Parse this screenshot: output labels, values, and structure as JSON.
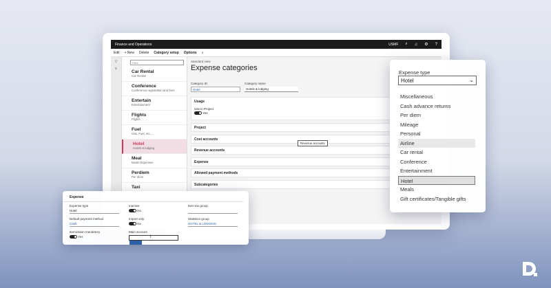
{
  "app": {
    "title": "Finance and Operations",
    "company": "USMF"
  },
  "toolbar": {
    "edit": "Edit",
    "new": "+ New",
    "delete": "Delete",
    "category_setup": "Category setup",
    "options": "Options"
  },
  "filter_placeholder": "Filter",
  "list": [
    {
      "title": "Car Rental",
      "sub": "Car Rental"
    },
    {
      "title": "Conference",
      "sub": "Conference registration and fees"
    },
    {
      "title": "Entertain",
      "sub": "Entertainment"
    },
    {
      "title": "Flights",
      "sub": "Flights"
    },
    {
      "title": "Fuel",
      "sub": "Gas, Fuel, etc..."
    },
    {
      "title": "Hotel",
      "sub": "Hotels & lodging"
    },
    {
      "title": "Meal",
      "sub": "Meals Expenses"
    },
    {
      "title": "Perdiem",
      "sub": "Per diem"
    },
    {
      "title": "Taxi",
      "sub": ""
    }
  ],
  "detail": {
    "standard_view": "Standard view",
    "title": "Expense categories",
    "category_id_label": "Category ID",
    "category_id": "Hotel",
    "category_name_label": "Category name",
    "category_name": "Hotels & lodging",
    "usage": "Usage",
    "use_in_project": "Use in Project",
    "use_in_project_value": "Yes",
    "sections": [
      "Project",
      "Cost accounts",
      "Revenue accounts",
      "Expense",
      "Allowed payment methods",
      "Subcategories"
    ],
    "tooltip": "Revenue accounts"
  },
  "expense_panel": {
    "header": "Expense",
    "expense_type_label": "Expense type",
    "expense_type": "Hotel",
    "default_payment_label": "Default payment method",
    "default_payment": "Cash",
    "itemization_label": "Itemization mandatory",
    "itemization": "Yes",
    "inactive_label": "Inactive",
    "inactive": "No",
    "import_only_label": "Import only",
    "import_only": "No",
    "main_account_label": "Main account",
    "main_account": "",
    "item_tax_label": "Item tax group",
    "statistics_label": "Statistics group",
    "statistics": "HOTEL & LODGING"
  },
  "type_panel": {
    "label": "Expense type",
    "selected": "Hotel",
    "options": [
      "Miscellaneous",
      "Cash advance returns",
      "Per diem",
      "Mileage",
      "Personal",
      "Airline",
      "Car rental",
      "Conference",
      "Entertainment",
      "Hotel",
      "Meals",
      "Gift certificates/Tangible gifts"
    ],
    "hover_index": 5,
    "chosen_index": 9
  }
}
